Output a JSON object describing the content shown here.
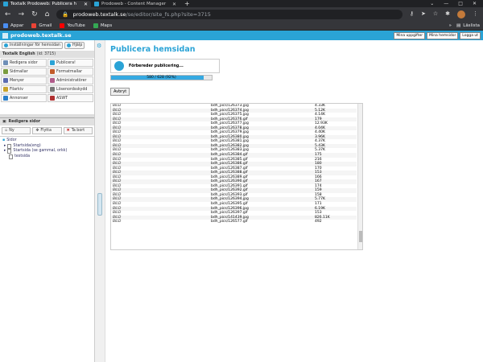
{
  "browser": {
    "tabs": [
      {
        "title": "Textalk Prodoweb: Publicera h",
        "active": true
      },
      {
        "title": "Prodoweb - Content Manager",
        "active": false
      }
    ],
    "new_tab": "+",
    "url_domain": "prodoweb.textalk.se",
    "url_path": "/se/editor/site_fs.php?site=3715",
    "bookmarks": [
      "Appar",
      "Gmail",
      "YouTube",
      "Maps"
    ],
    "reading_list": "Läslista"
  },
  "app": {
    "title": "prodoweb.textalk.se",
    "header_buttons": [
      "Mina uppgifter",
      "Mina hemsidor",
      "Logga ut"
    ]
  },
  "sidebar": {
    "top_tabs": [
      "Inställningar för hemsidan",
      "Hjälp"
    ],
    "site_name": "Textalk English",
    "site_id": "(id: 3715)",
    "grid": [
      {
        "label": "Redigera sidor",
        "color": "#6f8fb7"
      },
      {
        "label": "Publicera!",
        "color": "#2aa3d6"
      },
      {
        "label": "Sidmallar",
        "color": "#7a9c3f"
      },
      {
        "label": "Formatmallar",
        "color": "#c25b2a"
      },
      {
        "label": "Menyer",
        "color": "#5b6bb0"
      },
      {
        "label": "Administratörer",
        "color": "#b05b8a"
      },
      {
        "label": "Filarkiv",
        "color": "#c9a32a"
      },
      {
        "label": "Lösenordsskydd",
        "color": "#777"
      },
      {
        "label": "Annonser",
        "color": "#2a7fc9"
      },
      {
        "label": "ASWT",
        "color": "#b03030"
      }
    ],
    "edit_header": "Redigera sidor",
    "actions": [
      "Ny",
      "Flytta",
      "Ta bort"
    ],
    "tree": [
      "Sidor",
      "Startsida(eng)",
      "Startsida (se gammal, orkk)",
      "testsida"
    ]
  },
  "main": {
    "title": "Publicera hemsidan",
    "status": "Förbereder publicering...",
    "progress_text": "580 / 628 (92%)",
    "progress_fraction": 0.92,
    "abort": "Avbryt",
    "rows": [
      [
        "BILD",
        "bdh_pics/126373.jpg",
        "4.33K"
      ],
      [
        "BILD",
        "bdh_pics/126374.jpg",
        "5.12K"
      ],
      [
        "BILD",
        "bdh_pics/126375.jpg",
        "4.14K"
      ],
      [
        "BILD",
        "bdh_pics/126376.gif",
        "179"
      ],
      [
        "BILD",
        "bdh_pics/126377.jpg",
        "12.93K"
      ],
      [
        "BILD",
        "bdh_pics/126378.jpg",
        "4.04K"
      ],
      [
        "BILD",
        "bdh_pics/126379.jpg",
        "4.40K"
      ],
      [
        "BILD",
        "bdh_pics/126380.jpg",
        "3.96K"
      ],
      [
        "BILD",
        "bdh_pics/126381.jpg",
        "4.37K"
      ],
      [
        "BILD",
        "bdh_pics/126382.jpg",
        "5.43K"
      ],
      [
        "BILD",
        "bdh_pics/126383.jpg",
        "5.37K"
      ],
      [
        "BILD",
        "bdh_pics/126384.gif",
        "175"
      ],
      [
        "BILD",
        "bdh_pics/126385.gif",
        "216"
      ],
      [
        "BILD",
        "bdh_pics/126386.gif",
        "180"
      ],
      [
        "BILD",
        "bdh_pics/126387.gif",
        "170"
      ],
      [
        "BILD",
        "bdh_pics/126388.gif",
        "153"
      ],
      [
        "BILD",
        "bdh_pics/126389.gif",
        "166"
      ],
      [
        "BILD",
        "bdh_pics/126390.gif",
        "167"
      ],
      [
        "BILD",
        "bdh_pics/126391.gif",
        "174"
      ],
      [
        "BILD",
        "bdh_pics/126392.gif",
        "159"
      ],
      [
        "BILD",
        "bdh_pics/126393.gif",
        "158"
      ],
      [
        "BILD",
        "bdh_pics/126394.jpg",
        "5.77K"
      ],
      [
        "BILD",
        "bdh_pics/126395.gif",
        "171"
      ],
      [
        "BILD",
        "bdh_pics/126396.jpg",
        "6.19K"
      ],
      [
        "BILD",
        "bdh_pics/126397.gif",
        "153"
      ],
      [
        "BILD",
        "bdh_pics/141439.jpg",
        "826.11K"
      ],
      [
        "BILD",
        "bdh_pics/126577.gif",
        "492"
      ]
    ]
  }
}
